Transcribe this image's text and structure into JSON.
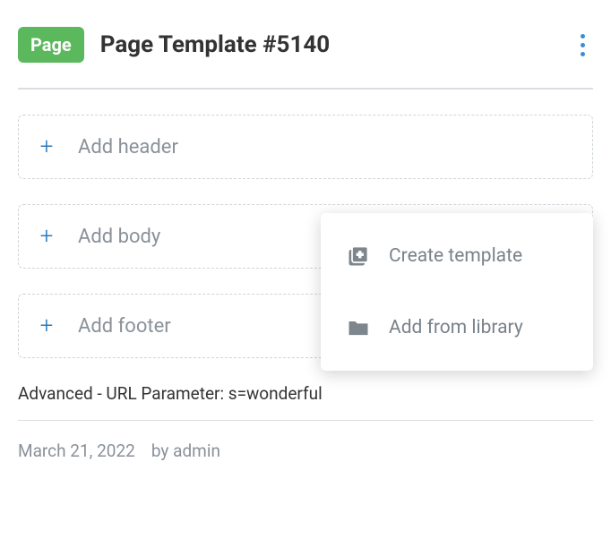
{
  "header": {
    "badge": "Page",
    "title": "Page Template #5140"
  },
  "zones": {
    "header": "Add header",
    "body": "Add body",
    "footer": "Add footer"
  },
  "dropdown": {
    "create": "Create template",
    "library": "Add from library"
  },
  "advanced_text": "Advanced - URL Parameter: s=wonderful",
  "meta": {
    "date": "March 21, 2022",
    "by": "by admin"
  }
}
